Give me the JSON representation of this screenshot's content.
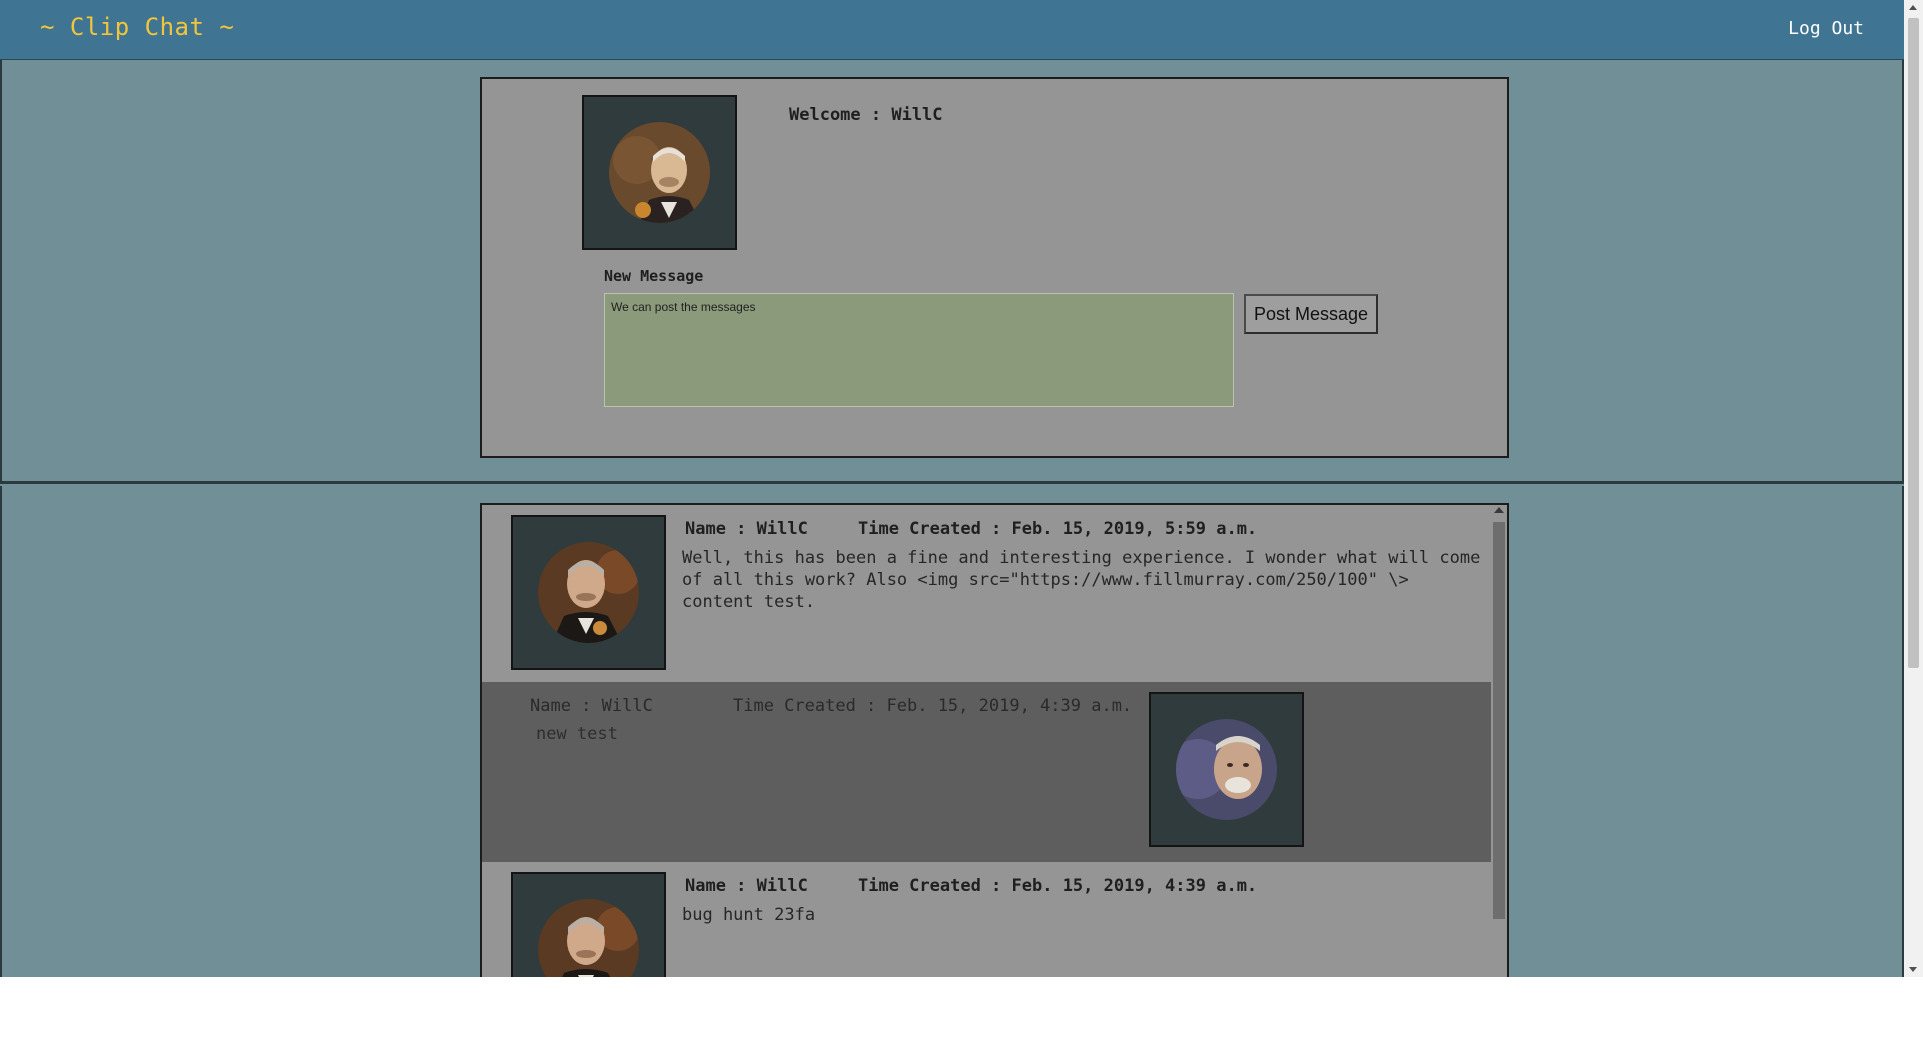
{
  "navbar": {
    "brand": "~ Clip Chat ~",
    "logout_label": "Log Out"
  },
  "profile": {
    "welcome_text": "Welcome : WillC",
    "avatar": "user-avatar-icon"
  },
  "compose": {
    "label": "New Message",
    "input_value": "We can post the messages",
    "post_button_label": "Post Message"
  },
  "messages": [
    {
      "name": "Name : WillC",
      "time": "Time Created : Feb. 15, 2019, 5:59 a.m.",
      "text": "Well, this has been a fine and interesting experience. I wonder what will come of all this work? Also <img src=\"https://www.fillmurray.com/250/100\" \\> content test.",
      "style": "own"
    },
    {
      "name": "Name : WillC",
      "time": "Time Created : Feb. 15, 2019, 4:39 a.m.",
      "text": "new test",
      "style": "other"
    },
    {
      "name": "Name : WillC",
      "time": "Time Created : Feb. 15, 2019, 4:39 a.m.",
      "text": "bug hunt 23fa",
      "style": "own"
    }
  ],
  "colors": {
    "navbar": "#3f7593",
    "brand": "#f2c53a",
    "page_bg": "#718f96",
    "card_bg": "#959595",
    "dark_message_bg": "#5e5e5e",
    "input_bg": "#8b9a7b"
  }
}
